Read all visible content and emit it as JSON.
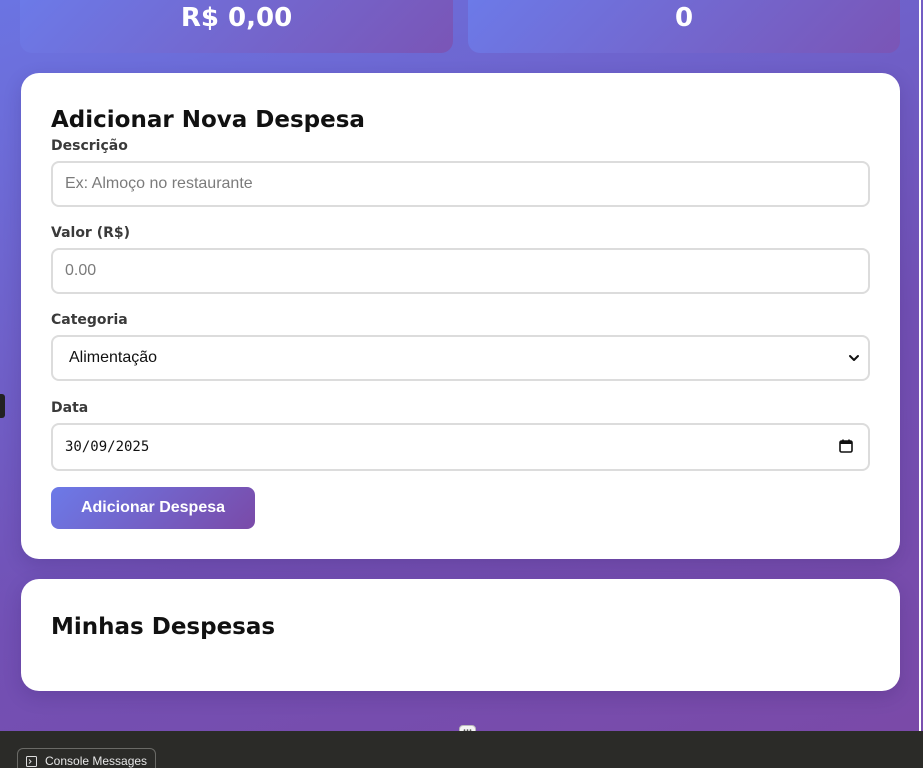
{
  "stats": {
    "total_value": "R$ 0,00",
    "count": "0"
  },
  "form": {
    "title": "Adicionar Nova Despesa",
    "description_label": "Descrição",
    "description_placeholder": "Ex: Almoço no restaurante",
    "value_label": "Valor (R$)",
    "value_placeholder": "0.00",
    "category_label": "Categoria",
    "category_selected": "Alimentação",
    "date_label": "Data",
    "date_value": "30/09/2025",
    "submit_label": "Adicionar Despesa"
  },
  "list": {
    "title": "Minhas Despesas"
  },
  "devtools": {
    "console_tab_label": "Console Messages"
  },
  "colors": {
    "gradient_start": "#6a6fe0",
    "gradient_end": "#7a4fae",
    "card_bg": "#ffffff",
    "devtools_bg": "#2b2b28"
  },
  "icons": {
    "select": "chevron-down-icon",
    "date": "calendar-icon",
    "console": "terminal-icon",
    "grip": "grip-icon"
  }
}
